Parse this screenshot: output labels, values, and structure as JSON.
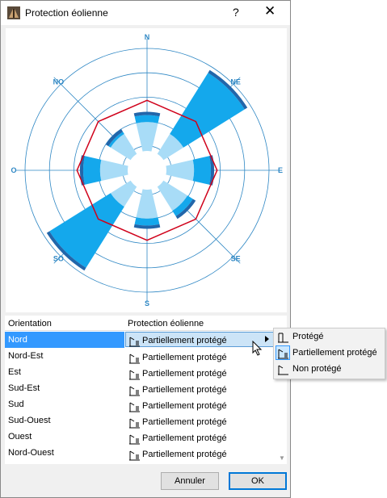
{
  "window": {
    "title": "Protection éolienne",
    "help": "?",
    "close": "✕"
  },
  "chart": {
    "directions": [
      "N",
      "NE",
      "E",
      "SE",
      "S",
      "SO",
      "O",
      "NO"
    ],
    "accent": "#2e87c4",
    "outline": "#d0021b"
  },
  "chart_data": {
    "type": "radar",
    "categories": [
      "N",
      "NE",
      "E",
      "SE",
      "S",
      "SO",
      "O",
      "NO"
    ],
    "title": "",
    "rings": 5,
    "wind_rose": {
      "inner": [
        0.3,
        0.3,
        0.3,
        0.3,
        0.3,
        0.3,
        0.3,
        0.3
      ],
      "outer": [
        0.48,
        0.97,
        0.55,
        0.47,
        0.48,
        0.97,
        0.55,
        0.4
      ],
      "light": [
        0.48,
        0.4,
        0.46,
        0.47,
        0.48,
        0.4,
        0.46,
        0.4
      ]
    },
    "protection_outline": [
      0.7,
      0.69,
      0.7,
      0.69,
      0.7,
      0.69,
      0.7,
      0.69
    ]
  },
  "table": {
    "headers": {
      "orientation": "Orientation",
      "protection": "Protection éolienne"
    },
    "rows": [
      {
        "orientation": "Nord",
        "protection": "Partiellement protégé"
      },
      {
        "orientation": "Nord-Est",
        "protection": "Partiellement protégé"
      },
      {
        "orientation": "Est",
        "protection": "Partiellement protégé"
      },
      {
        "orientation": "Sud-Est",
        "protection": "Partiellement protégé"
      },
      {
        "orientation": "Sud",
        "protection": "Partiellement protégé"
      },
      {
        "orientation": "Sud-Ouest",
        "protection": "Partiellement protégé"
      },
      {
        "orientation": "Ouest",
        "protection": "Partiellement protégé"
      },
      {
        "orientation": "Nord-Ouest",
        "protection": "Partiellement protégé"
      }
    ]
  },
  "menu": {
    "items": [
      {
        "label": "Protégé",
        "icon": "protected-icon",
        "checked": false
      },
      {
        "label": "Partiellement protégé",
        "icon": "partially-protected-icon",
        "checked": true
      },
      {
        "label": "Non protégé",
        "icon": "unprotected-icon",
        "checked": false
      }
    ]
  },
  "buttons": {
    "cancel": "Annuler",
    "ok": "OK"
  }
}
